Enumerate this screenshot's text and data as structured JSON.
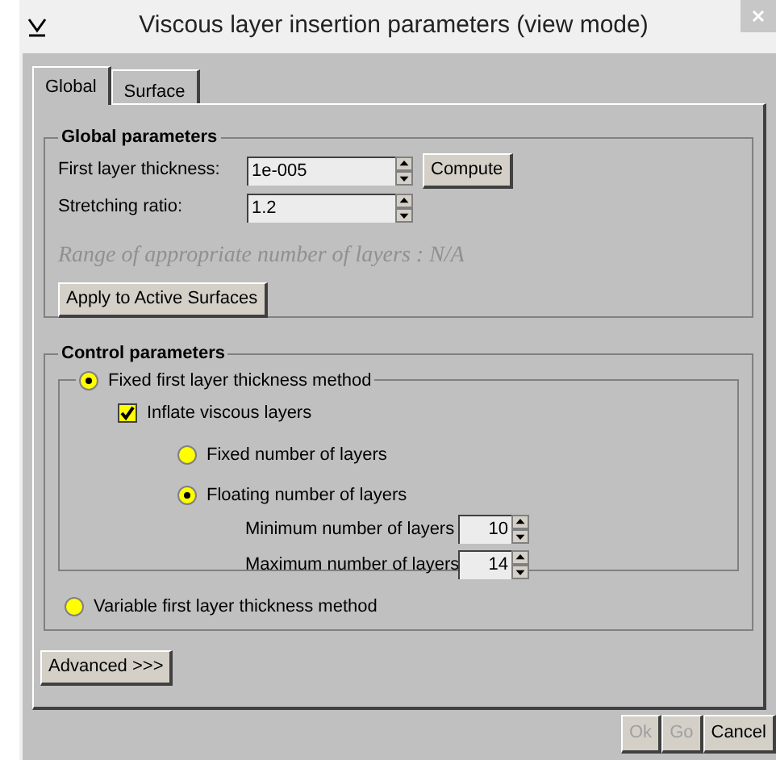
{
  "window": {
    "title": "Viscous layer insertion parameters (view mode)"
  },
  "tabs": [
    {
      "label": "Global",
      "selected": true
    },
    {
      "label": "Surface",
      "selected": false
    }
  ],
  "global_parameters": {
    "title": "Global parameters",
    "fields": [
      {
        "label": "First layer thickness:",
        "value": "1e-005"
      },
      {
        "label": "Stretching ratio:",
        "value": "1.2"
      }
    ],
    "compute_button": "Compute",
    "range_text": "Range of appropriate number of layers : N/A",
    "apply_button": "Apply to Active Surfaces"
  },
  "control_parameters": {
    "title": "Control parameters",
    "methods": [
      {
        "label": "Fixed first layer thickness method",
        "selected": true
      },
      {
        "label": "Variable first layer thickness method",
        "selected": false
      }
    ],
    "inflate": {
      "label": "Inflate viscous layers",
      "checked": true
    },
    "layer_modes": [
      {
        "label": "Fixed number of layers",
        "selected": false
      },
      {
        "label": "Floating number of layers",
        "selected": true
      }
    ],
    "limits": [
      {
        "label": "Minimum number of layers",
        "value": "10"
      },
      {
        "label": "Maximum number of layers",
        "value": "14"
      }
    ]
  },
  "advanced_button": "Advanced >>>",
  "footer_buttons": [
    {
      "label": "Ok",
      "disabled": true
    },
    {
      "label": "Go",
      "disabled": true
    },
    {
      "label": "Cancel",
      "disabled": false
    }
  ]
}
